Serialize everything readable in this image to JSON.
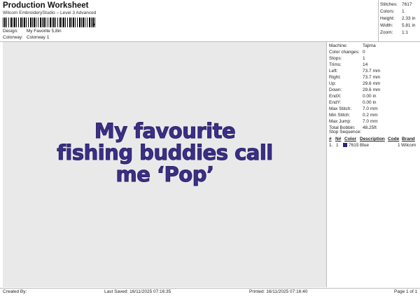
{
  "header": {
    "title": "Production Worksheet",
    "subtitle": "Wilcom EmbroideryStudio – Level 3 Advanced",
    "barcode_tail": ","
  },
  "meta": {
    "design_label": "Design:",
    "design_value": "My Favorite 5,8in",
    "colorway_label": "Colorway:",
    "colorway_value": "Colorway 1"
  },
  "summary": [
    {
      "label": "Stitches:",
      "value": "7617"
    },
    {
      "label": "Colors:",
      "value": "1"
    },
    {
      "label": "Height:",
      "value": "2.33 in"
    },
    {
      "label": "Width:",
      "value": "5.81 in"
    },
    {
      "label": "Zoom:",
      "value": "1:1"
    }
  ],
  "design": {
    "lines": [
      "My favourite",
      "fishing buddies call",
      "me ‘Pop’"
    ],
    "thread_color": "#3b2f86"
  },
  "info": [
    {
      "label": "Machine:",
      "value": "Tajima"
    },
    {
      "label": "Color changes:",
      "value": "0"
    },
    {
      "label": "Stops:",
      "value": "1"
    },
    {
      "label": "Trims:",
      "value": "14"
    },
    {
      "label": "Left:",
      "value": "73.7 mm"
    },
    {
      "label": "Right:",
      "value": "73.7 mm"
    },
    {
      "label": "Up:",
      "value": "29.6 mm"
    },
    {
      "label": "Down:",
      "value": "29.6 mm"
    },
    {
      "label": "EndX:",
      "value": "0.00 in"
    },
    {
      "label": "EndY:",
      "value": "0.00 in"
    },
    {
      "label": "Max Stitch:",
      "value": "7.0 mm"
    },
    {
      "label": "Min Stitch:",
      "value": "0.2 mm"
    },
    {
      "label": "Max Jump:",
      "value": "7.0 mm"
    },
    {
      "label": "Total Bobbin:",
      "value": "48.25ft"
    }
  ],
  "stop_sequence": {
    "label": "Stop Sequence:",
    "headers": {
      "number": "#",
      "n": "N#",
      "color": "Color",
      "description": "Description",
      "code": "Code",
      "brand": "Brand"
    },
    "rows": [
      {
        "number": "1.",
        "n": "1",
        "color_id": "7615",
        "description": "Blue",
        "code": "1",
        "brand": "Wilcom",
        "swatch": "#2b2575"
      }
    ]
  },
  "footer": {
    "created_by": "Created By:",
    "last_saved": "Last Saved: 16/11/2025 07:16:35",
    "printed": "Printed: 16/11/2025 07:16:40",
    "page": "Page 1 of 1"
  }
}
